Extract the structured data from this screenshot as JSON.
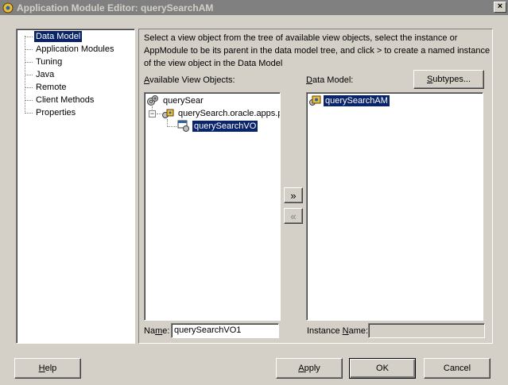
{
  "window": {
    "title": "Application Module Editor: querySearchAM",
    "close_label": "×"
  },
  "nav": {
    "items": [
      {
        "label": "Data Model",
        "selected": true
      },
      {
        "label": "Application Modules"
      },
      {
        "label": "Tuning"
      },
      {
        "label": "Java"
      },
      {
        "label": "Remote"
      },
      {
        "label": "Client Methods"
      },
      {
        "label": "Properties"
      }
    ]
  },
  "main": {
    "description": [
      "Select a view object from the tree of available view objects, select the instance or",
      "AppModule to be its parent in the data model tree, and click > to create a named instance",
      "of the view object in the Data Model"
    ],
    "available_label_pre": "",
    "available_label_mn": "A",
    "available_label_post": "vailable View Objects:",
    "data_model_label_pre": "",
    "data_model_label_mn": "D",
    "data_model_label_post": "ata Model:",
    "subtypes_pre": "",
    "subtypes_mn": "S",
    "subtypes_post": "ubtypes...",
    "available_tree": {
      "root": "querySear",
      "package": "querySearch.oracle.apps.p",
      "view_object": "querySearchVO"
    },
    "data_model_tree": {
      "root": "querySearchAM"
    },
    "add_arrow": "»",
    "remove_arrow": "«",
    "name_label_pre": "Na",
    "name_label_mn": "m",
    "name_label_post": "e:",
    "name_value": "querySearchVO1",
    "instance_label_pre": "Instance ",
    "instance_label_mn": "N",
    "instance_label_post": "ame:",
    "instance_value": ""
  },
  "footer": {
    "help_pre": "",
    "help_mn": "H",
    "help_post": "elp",
    "apply_pre": "",
    "apply_mn": "A",
    "apply_post": "pply",
    "ok_label": "OK",
    "cancel_label": "Cancel"
  },
  "colors": {
    "selection": "#0a246a",
    "dialog_bg": "#d4d0c8",
    "titlebar_inactive": "#808080"
  }
}
